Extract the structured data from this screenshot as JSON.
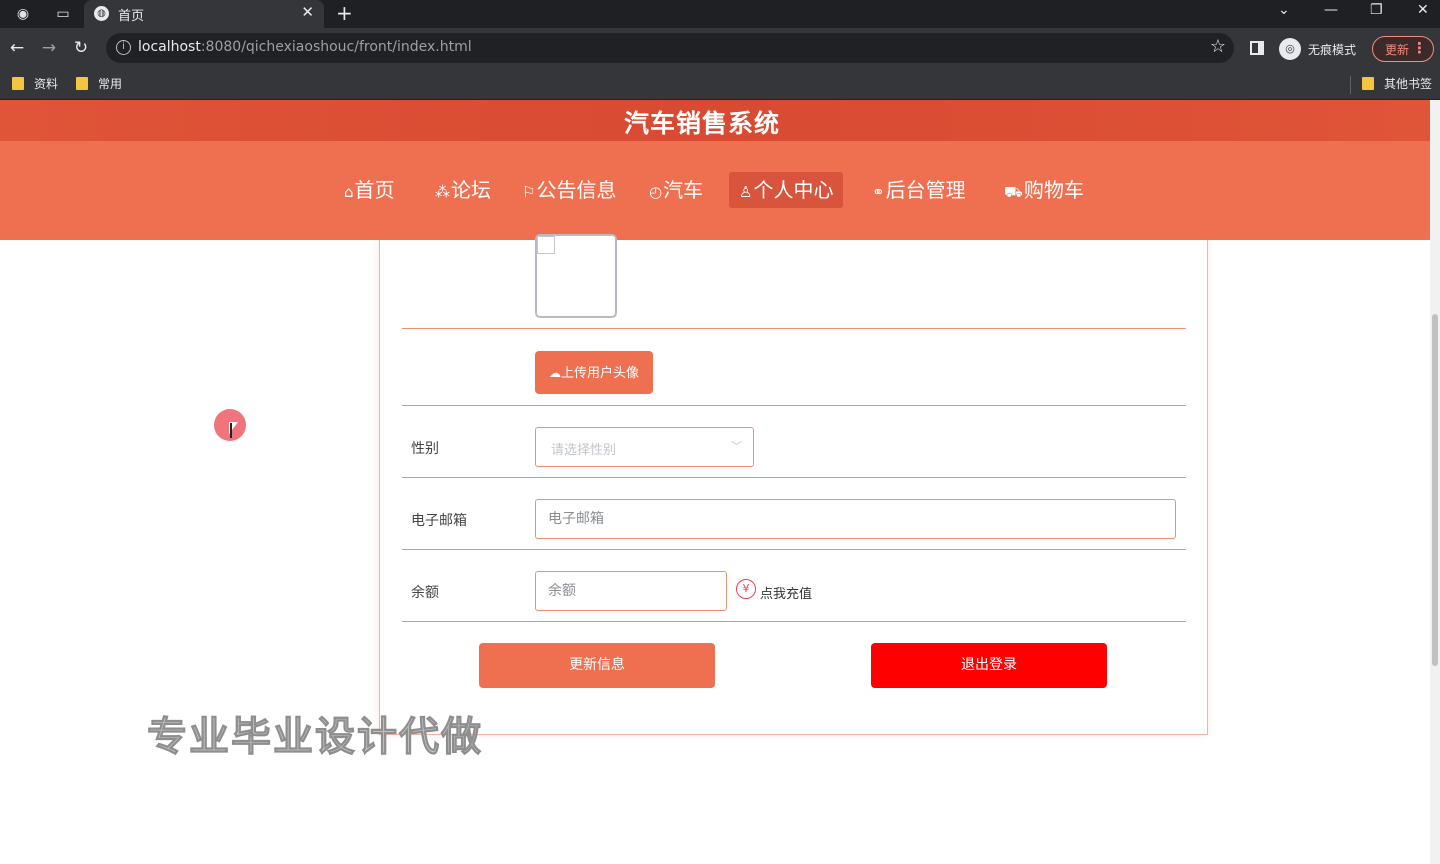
{
  "browser": {
    "tab_title": "首页",
    "url_host": "localhost",
    "url_rest": ":8080/qichexiaoshouc/front/index.html",
    "incognito_label": "无痕模式",
    "update_label": "更新",
    "bookmarks": [
      "资料",
      "常用"
    ],
    "other_bookmarks": "其他书签"
  },
  "site": {
    "title": "汽车销售系统",
    "nav": [
      {
        "icon": "⌂",
        "label": "首页"
      },
      {
        "icon": "⁂",
        "label": "论坛"
      },
      {
        "icon": "⚐",
        "label": "公告信息"
      },
      {
        "icon": "◴",
        "label": "汽车"
      },
      {
        "icon": "♙",
        "label": "个人中心"
      },
      {
        "icon": "⚭",
        "label": "后台管理"
      },
      {
        "icon": "⛟",
        "label": "购物车"
      }
    ],
    "active_nav": "个人中心"
  },
  "form": {
    "upload_label": "上传用户头像",
    "gender_label": "性别",
    "gender_placeholder": "请选择性别",
    "email_label": "电子邮箱",
    "email_placeholder": "电子邮箱",
    "balance_label": "余额",
    "balance_placeholder": "余额",
    "recharge_label": "点我充值",
    "update_button": "更新信息",
    "logout_button": "退出登录"
  },
  "watermark": "专业毕业设计代做",
  "colors": {
    "accent": "#ef7050",
    "header_dark": "#d84a32",
    "danger": "#ff0000"
  }
}
